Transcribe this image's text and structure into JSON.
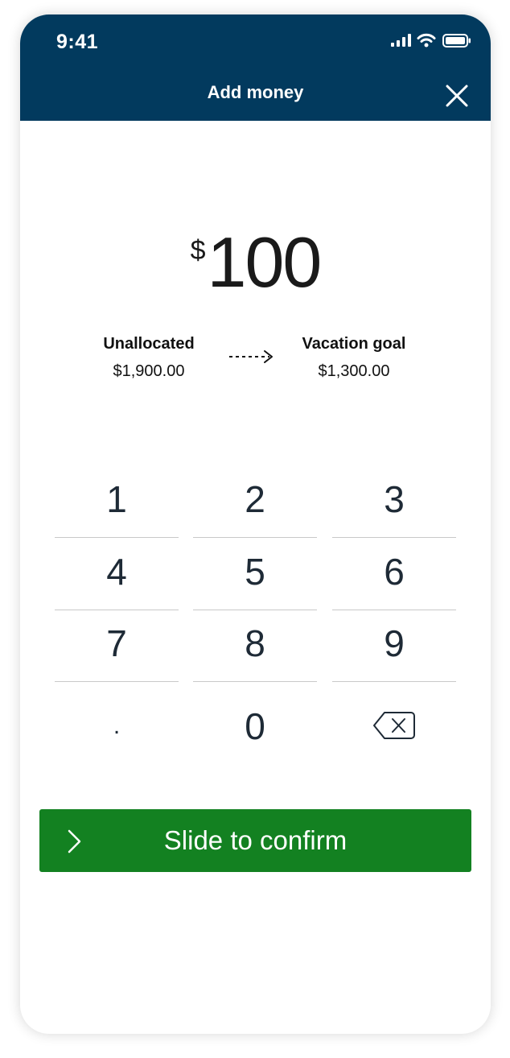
{
  "status_bar": {
    "time": "9:41",
    "icons": [
      "signal-icon",
      "wifi-icon",
      "battery-icon"
    ]
  },
  "header": {
    "title": "Add money",
    "close_icon": "close-icon",
    "background_color": "#023a5e"
  },
  "amount": {
    "currency": "$",
    "value": "100"
  },
  "transfer": {
    "from": {
      "name": "Unallocated",
      "balance": "$1,900.00"
    },
    "arrow_icon": "dashed-arrow-right-icon",
    "to": {
      "name": "Vacation goal",
      "balance": "$1,300.00"
    }
  },
  "keypad": {
    "keys": [
      "1",
      "2",
      "3",
      "4",
      "5",
      "6",
      "7",
      "8",
      "9",
      ".",
      "0"
    ],
    "backspace_icon": "backspace-icon"
  },
  "confirm": {
    "label": "Slide to confirm",
    "icon": "chevron-right-icon",
    "color": "#138121"
  }
}
